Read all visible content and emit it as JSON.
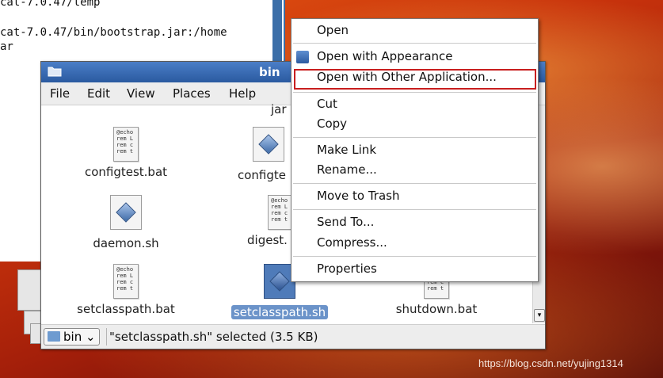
{
  "terminal": {
    "lines": [
      "cat-7.0.47/temp",
      "",
      "cat-7.0.47/bin/bootstrap.jar:/home",
      "ar"
    ]
  },
  "file_manager": {
    "title": "bin",
    "menu": [
      "File",
      "Edit",
      "View",
      "Places",
      "Help"
    ],
    "partial_label": "jar",
    "files": [
      {
        "name": "configtest.bat",
        "icon": "bat-file-icon",
        "thumb": "@echo\nrem L\nrem c\nrem t"
      },
      {
        "name": "configte",
        "icon": "sh-file-icon"
      },
      {
        "name": "daemon.sh",
        "icon": "sh-file-icon"
      },
      {
        "name": "digest.",
        "icon": "bat-file-icon",
        "thumb": "@echo\nrem L\nrem c\nrem t"
      },
      {
        "name": "setclasspath.bat",
        "icon": "bat-file-icon",
        "thumb": "@echo\nrem L\nrem c\nrem t"
      },
      {
        "name": "setclasspath.sh",
        "icon": "sh-file-icon",
        "selected": true
      },
      {
        "name": "shutdown.bat",
        "icon": "bat-file-icon",
        "thumb": "rem c\nrem t"
      }
    ],
    "location_button": "bin",
    "status": "\"setclasspath.sh\" selected (3.5 KB)"
  },
  "context_menu": {
    "items": [
      {
        "label": "Open"
      },
      {
        "label": "Open with Appearance",
        "icon": "appearance-icon"
      },
      {
        "label": "Open with Other Application...",
        "highlighted": true
      },
      {
        "label": "Cut"
      },
      {
        "label": "Copy"
      },
      {
        "label": "Make Link"
      },
      {
        "label": "Rename..."
      },
      {
        "label": "Move to Trash"
      },
      {
        "label": "Send To..."
      },
      {
        "label": "Compress..."
      },
      {
        "label": "Properties"
      }
    ],
    "highlight_color": "#c81e1e"
  },
  "watermark": "https://blog.csdn.net/yujing1314"
}
